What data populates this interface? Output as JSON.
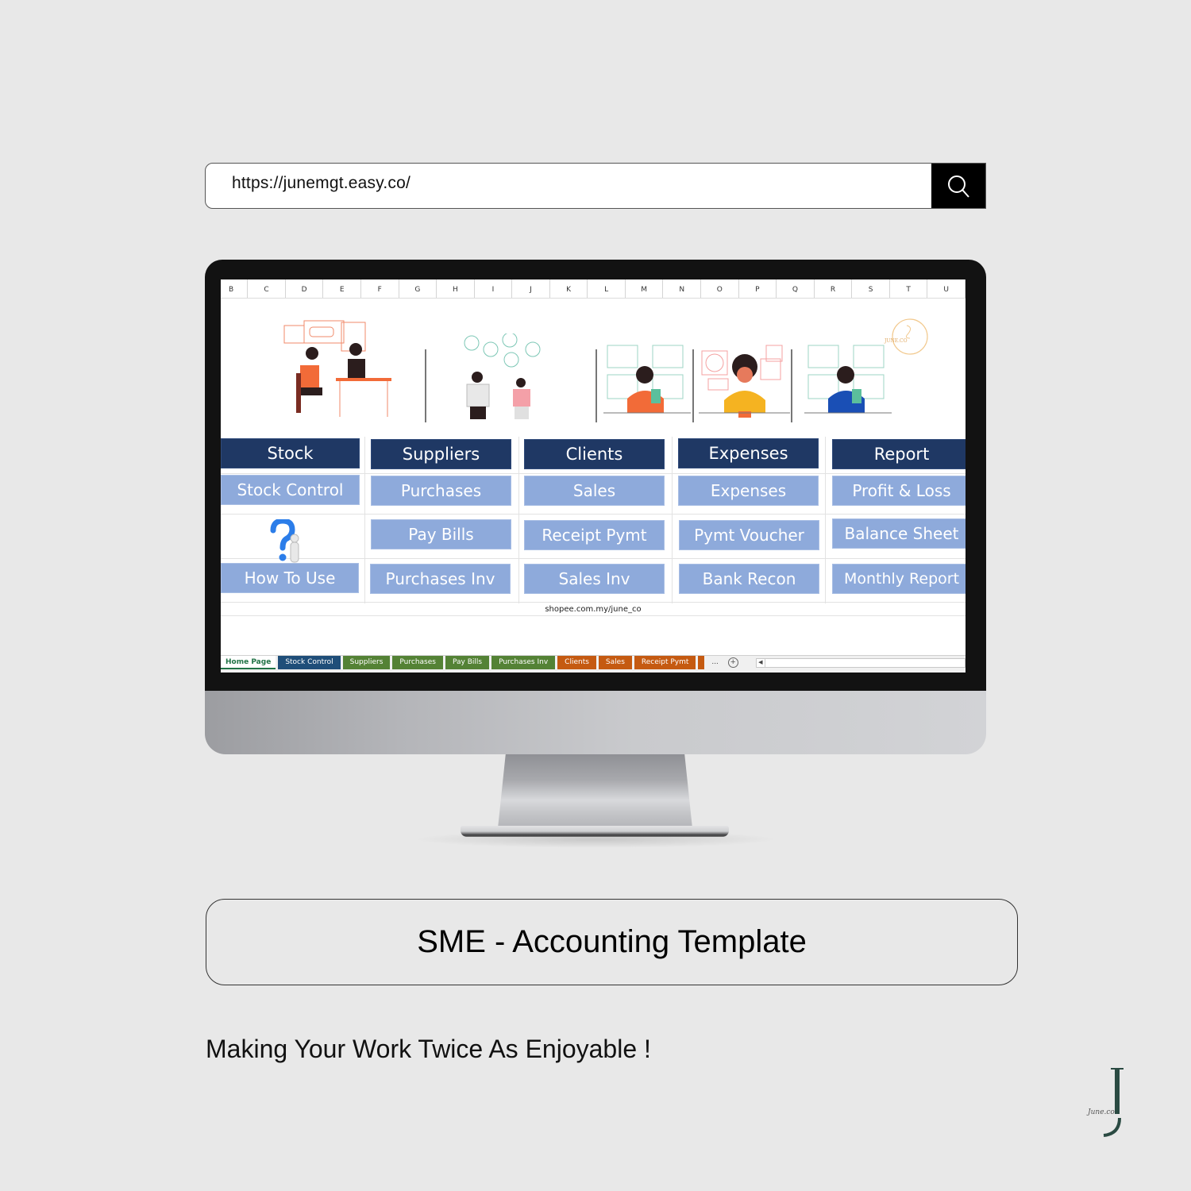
{
  "url_bar": {
    "url": "https://junemgt.easy.co/",
    "search_icon": "search-icon"
  },
  "spreadsheet": {
    "columns": [
      "B",
      "C",
      "D",
      "E",
      "F",
      "G",
      "H",
      "I",
      "J",
      "K",
      "L",
      "M",
      "N",
      "O",
      "P",
      "Q",
      "R",
      "S",
      "T",
      "U"
    ],
    "illustrations": [
      {
        "name": "loan-meeting-illustration"
      },
      {
        "name": "team-discussion-illustration"
      },
      {
        "name": "woman-counting-cash-orange-illustration"
      },
      {
        "name": "woman-writing-accounts-illustration"
      },
      {
        "name": "woman-counting-cash-blue-illustration"
      }
    ],
    "watermark_logo_text": "JUNE.CO",
    "sections": [
      {
        "header": "Stock",
        "items": [
          "Stock Control"
        ],
        "extra": {
          "help_label": "How To Use",
          "icon": "question-mark-icon"
        }
      },
      {
        "header": "Suppliers",
        "items": [
          "Purchases",
          "Pay Bills",
          "Purchases Inv"
        ]
      },
      {
        "header": "Clients",
        "items": [
          "Sales",
          "Receipt Pymt",
          "Sales Inv"
        ]
      },
      {
        "header": "Expenses",
        "items": [
          "Expenses",
          "Pymt Voucher",
          "Bank Recon"
        ]
      },
      {
        "header": "Report",
        "items": [
          "Profit & Loss",
          "Balance Sheet",
          "Monthly Report"
        ]
      }
    ],
    "footer_link": "shopee.com.my/june_co",
    "sheet_tabs": [
      {
        "label": "Home Page",
        "color": "#ffffff",
        "active": true
      },
      {
        "label": "Stock Control",
        "color": "#1f4e79"
      },
      {
        "label": "Suppliers",
        "color": "#548235"
      },
      {
        "label": "Purchases",
        "color": "#548235"
      },
      {
        "label": "Pay Bills",
        "color": "#548235"
      },
      {
        "label": "Purchases Inv",
        "color": "#548235"
      },
      {
        "label": "Clients",
        "color": "#c55a11"
      },
      {
        "label": "Sales",
        "color": "#c55a11"
      },
      {
        "label": "Receipt Pymt",
        "color": "#c55a11"
      },
      {
        "label": "",
        "color": "#c55a11"
      }
    ],
    "more_tabs": "...",
    "add_sheet": "+",
    "colors": {
      "header_button": "#1f3864",
      "sub_button": "#8eaadb"
    }
  },
  "title_card": {
    "title": "SME - Accounting Template"
  },
  "tagline": "Making Your Work Twice As Enjoyable !",
  "brand_logo": {
    "text": "June.co"
  }
}
